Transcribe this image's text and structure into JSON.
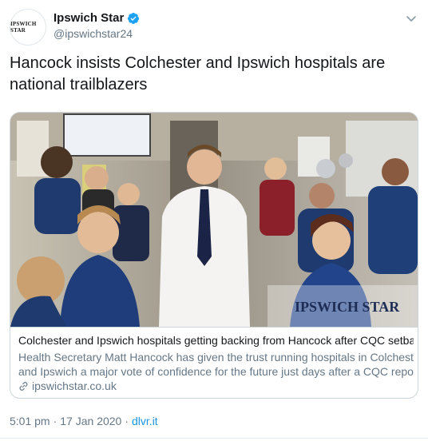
{
  "account": {
    "display_name": "Ipswich Star",
    "handle": "@ipswichstar24",
    "avatar_text": "IPSWICH STAR"
  },
  "tweet": {
    "text_line1": "Hancock insists Colchester and Ipswich hospitals are",
    "text_line2": "national trailblazers"
  },
  "card": {
    "watermark": "IPSWICH STAR",
    "title": "Colchester and Ipswich hospitals getting backing from Hancock after CQC setback",
    "desc_line1": "Health Secretary Matt Hancock has given the trust running hospitals in Colchester",
    "desc_line2": "and Ipswich a major vote of confidence for the future just days after a CQC report...",
    "domain": "ipswichstar.co.uk"
  },
  "meta": {
    "time": "5:01 pm",
    "separator1": "·",
    "date": "17 Jan 2020",
    "separator2": "·",
    "source": "dlvr.it"
  },
  "colors": {
    "verified_blue": "#1da1f2",
    "link_blue": "#1b95e0",
    "secondary_text": "#657786"
  },
  "icons": {
    "verified": "verified-badge-icon",
    "chevron": "chevron-down-icon",
    "link": "link-icon"
  }
}
